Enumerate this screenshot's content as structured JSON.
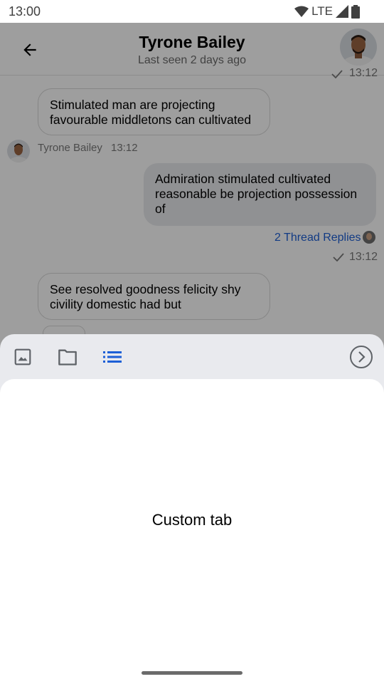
{
  "status_bar": {
    "time": "13:00",
    "network": "LTE"
  },
  "header": {
    "title": "Tyrone Bailey",
    "subtitle": "Last seen 2 days ago"
  },
  "messages": {
    "top_partial_time": "13:12",
    "msg1": "Stimulated man are projecting favourable middletons can cultivated",
    "msg1_author": "Tyrone Bailey",
    "msg1_time": "13:12",
    "msg2": "Admiration stimulated cultivated reasonable be projection possession of",
    "msg2_thread": "2 Thread Replies",
    "msg2_time": "13:12",
    "msg3": "See resolved goodness felicity shy civility domestic had but"
  },
  "sheet": {
    "tabs": [
      "image-tab",
      "folder-tab",
      "custom-list-tab"
    ],
    "active_tab": "custom-list-tab",
    "body_text": "Custom tab"
  },
  "colors": {
    "accent": "#1d5fd6",
    "overlay": "rgba(0,0,0,0.38)",
    "sheet_bg": "#e9eaee"
  }
}
